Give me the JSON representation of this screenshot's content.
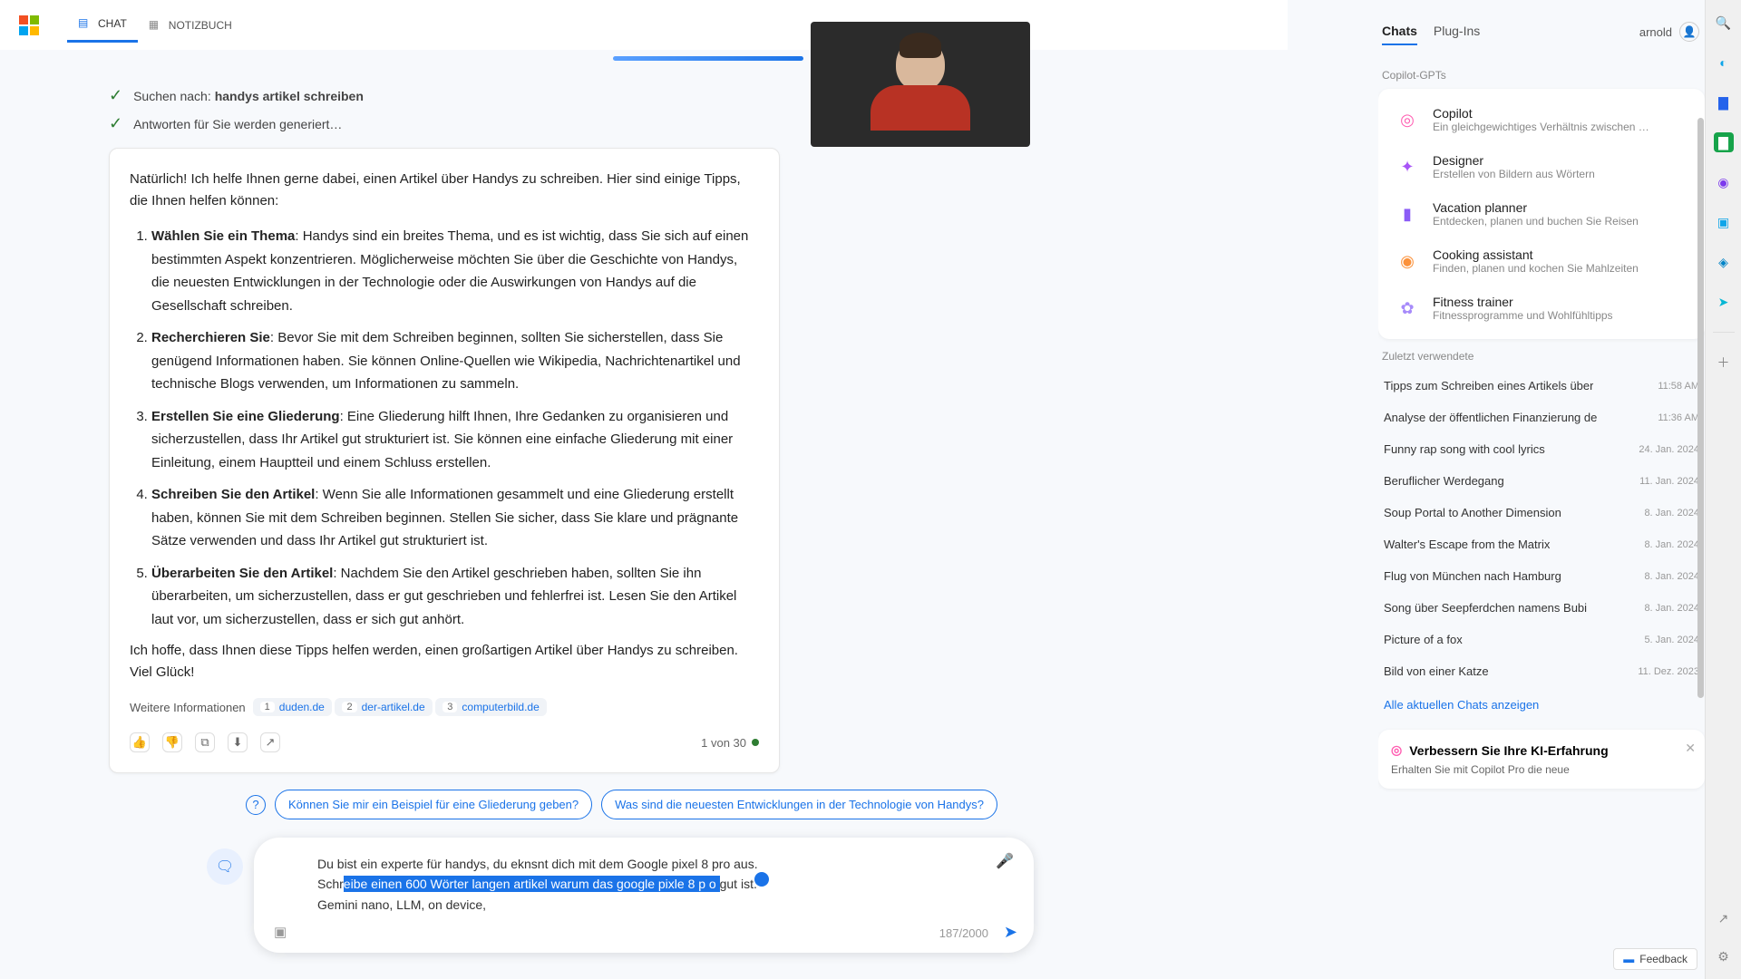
{
  "header": {
    "tabs": [
      {
        "label": "CHAT",
        "active": true
      },
      {
        "label": "NOTIZBUCH",
        "active": false
      }
    ]
  },
  "status": {
    "search_prefix": "Suchen nach: ",
    "search_query": "handys artikel schreiben",
    "generating": "Antworten für Sie werden generiert…"
  },
  "response": {
    "intro": "Natürlich! Ich helfe Ihnen gerne dabei, einen Artikel über Handys zu schreiben. Hier sind einige Tipps, die Ihnen helfen können:",
    "items": [
      {
        "title": "Wählen Sie ein Thema",
        "body": ": Handys sind ein breites Thema, und es ist wichtig, dass Sie sich auf einen bestimmten Aspekt konzentrieren. Möglicherweise möchten Sie über die Geschichte von Handys, die neuesten Entwicklungen in der Technologie oder die Auswirkungen von Handys auf die Gesellschaft schreiben."
      },
      {
        "title": "Recherchieren Sie",
        "body": ": Bevor Sie mit dem Schreiben beginnen, sollten Sie sicherstellen, dass Sie genügend Informationen haben. Sie können Online-Quellen wie Wikipedia, Nachrichtenartikel und technische Blogs verwenden, um Informationen zu sammeln."
      },
      {
        "title": "Erstellen Sie eine Gliederung",
        "body": ": Eine Gliederung hilft Ihnen, Ihre Gedanken zu organisieren und sicherzustellen, dass Ihr Artikel gut strukturiert ist. Sie können eine einfache Gliederung mit einer Einleitung, einem Hauptteil und einem Schluss erstellen."
      },
      {
        "title": "Schreiben Sie den Artikel",
        "body": ": Wenn Sie alle Informationen gesammelt und eine Gliederung erstellt haben, können Sie mit dem Schreiben beginnen. Stellen Sie sicher, dass Sie klare und prägnante Sätze verwenden und dass Ihr Artikel gut strukturiert ist."
      },
      {
        "title": "Überarbeiten Sie den Artikel",
        "body": ": Nachdem Sie den Artikel geschrieben haben, sollten Sie ihn überarbeiten, um sicherzustellen, dass er gut geschrieben und fehlerfrei ist. Lesen Sie den Artikel laut vor, um sicherzustellen, dass er sich gut anhört."
      }
    ],
    "outro": "Ich hoffe, dass Ihnen diese Tipps helfen werden, einen großartigen Artikel über Handys zu schreiben. Viel Glück!",
    "more_info_label": "Weitere Informationen",
    "sources": [
      {
        "num": "1",
        "name": "duden.de"
      },
      {
        "num": "2",
        "name": "der-artikel.de"
      },
      {
        "num": "3",
        "name": "computerbild.de"
      }
    ],
    "counter": "1 von 30"
  },
  "suggestions": [
    "Können Sie mir ein Beispiel für eine Gliederung geben?",
    "Was sind die neuesten Entwicklungen in der Technologie von Handys?"
  ],
  "input": {
    "line1": "Du bist ein experte für handys, du eknsnt dich mit dem Google pixel 8 pro aus.",
    "line2_pre": "Schr",
    "line2_hl": "eibe einen 600 Wörter langen artikel warum das google pixle 8 p o ",
    "line2_post": "gut ist.",
    "line3": "Gemini nano, LLM, on device,",
    "char_count": "187/2000"
  },
  "sidebar": {
    "tabs": [
      {
        "label": "Chats",
        "active": true
      },
      {
        "label": "Plug-Ins",
        "active": false
      }
    ],
    "user": "arnold",
    "gpt_label": "Copilot-GPTs",
    "gpts": [
      {
        "name": "Copilot",
        "desc": "Ein gleichgewichtiges Verhältnis zwischen KI u",
        "color": "#ff5db1",
        "icon": "◎"
      },
      {
        "name": "Designer",
        "desc": "Erstellen von Bildern aus Wörtern",
        "color": "#a855f7",
        "icon": "✦"
      },
      {
        "name": "Vacation planner",
        "desc": "Entdecken, planen und buchen Sie Reisen",
        "color": "#8b5cf6",
        "icon": "▮"
      },
      {
        "name": "Cooking assistant",
        "desc": "Finden, planen und kochen Sie Mahlzeiten",
        "color": "#fb923c",
        "icon": "◉"
      },
      {
        "name": "Fitness trainer",
        "desc": "Fitnessprogramme und Wohlfühltipps",
        "color": "#a78bfa",
        "icon": "✿"
      }
    ],
    "recent_label": "Zuletzt verwendete",
    "recent": [
      {
        "title": "Tipps zum Schreiben eines Artikels über",
        "ts": "11:58 AM"
      },
      {
        "title": "Analyse der öffentlichen Finanzierung de",
        "ts": "11:36 AM"
      },
      {
        "title": "Funny rap song with cool lyrics",
        "ts": "24. Jan. 2024"
      },
      {
        "title": "Beruflicher Werdegang",
        "ts": "11. Jan. 2024"
      },
      {
        "title": "Soup Portal to Another Dimension",
        "ts": "8. Jan. 2024"
      },
      {
        "title": "Walter's Escape from the Matrix",
        "ts": "8. Jan. 2024"
      },
      {
        "title": "Flug von München nach Hamburg",
        "ts": "8. Jan. 2024"
      },
      {
        "title": "Song über Seepferdchen namens Bubi",
        "ts": "8. Jan. 2024"
      },
      {
        "title": "Picture of a fox",
        "ts": "5. Jan. 2024"
      },
      {
        "title": "Bild von einer Katze",
        "ts": "11. Dez. 2023"
      }
    ],
    "show_all": "Alle aktuellen Chats anzeigen",
    "promo_title": "Verbessern Sie Ihre KI-Erfahrung",
    "promo_desc": "Erhalten Sie mit Copilot Pro die neue"
  },
  "feedback": "Feedback",
  "rail": {
    "icons": [
      "search-icon",
      "edge-icon",
      "word-icon",
      "excel-icon",
      "powerpoint-icon",
      "outlook-icon",
      "onenote-icon",
      "send-icon",
      "add-icon"
    ]
  }
}
